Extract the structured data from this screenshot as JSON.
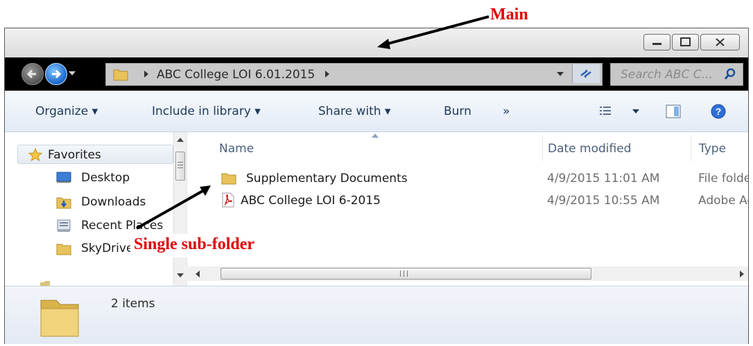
{
  "annotations": {
    "main": "Main",
    "subfolder": "Single sub-folder"
  },
  "address_bar": {
    "breadcrumb_text": "ABC College LOI 6.01.2015",
    "search_placeholder": "Search ABC C..."
  },
  "toolbar": {
    "organize": "Organize",
    "include_in_library": "Include in library",
    "share_with": "Share with",
    "burn": "Burn",
    "more": "»"
  },
  "nav_pane": {
    "items": [
      {
        "label": "Favorites",
        "icon": "star-icon"
      },
      {
        "label": "Desktop",
        "icon": "desktop-icon"
      },
      {
        "label": "Downloads",
        "icon": "downloads-folder-icon"
      },
      {
        "label": "Recent Places",
        "icon": "recent-places-icon"
      },
      {
        "label": "SkyDrive",
        "icon": "folder-icon"
      }
    ]
  },
  "file_list": {
    "columns": [
      "Name",
      "Date modified",
      "Type"
    ],
    "rows": [
      {
        "name": "Supplementary Documents",
        "date_modified": "4/9/2015 11:01 AM",
        "type": "File folder",
        "icon": "folder-icon"
      },
      {
        "name": "ABC College LOI 6-2015",
        "date_modified": "4/9/2015 10:55 AM",
        "type": "Adobe Acrobat Document",
        "icon": "pdf-icon"
      }
    ]
  },
  "details_pane": {
    "item_count": "2 items"
  },
  "colors": {
    "annotation": "#e00000",
    "address_bar_bg": "#000000",
    "toolbar_text": "#1e395b"
  }
}
